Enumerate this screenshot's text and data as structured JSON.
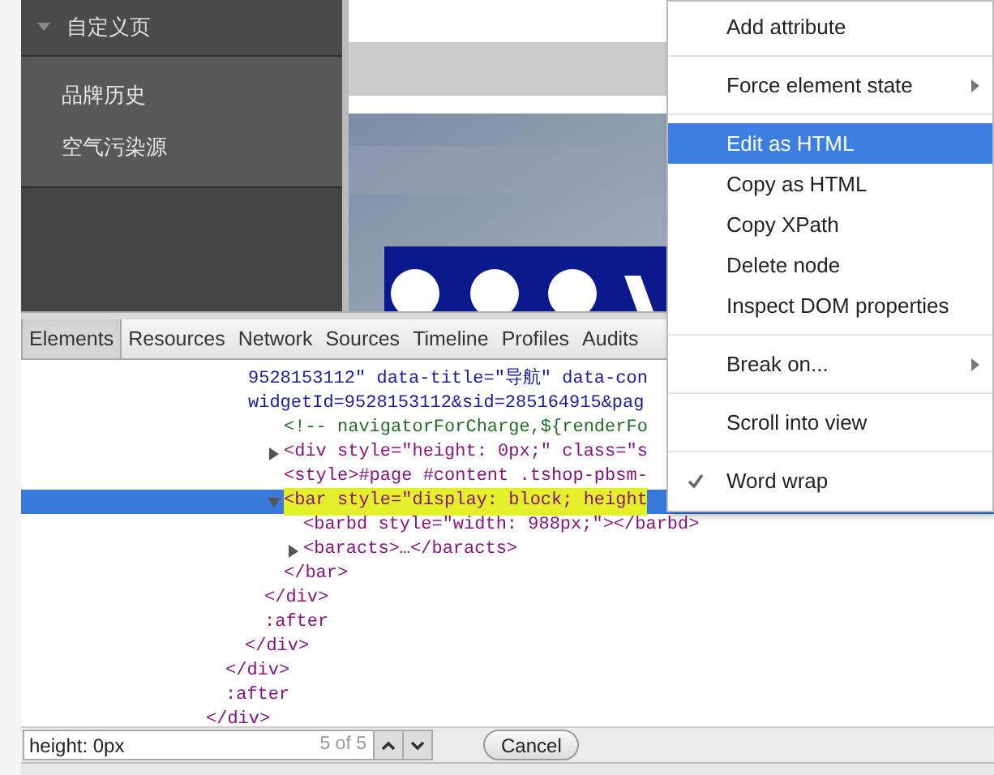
{
  "sidebar": {
    "header": {
      "label": "自定义页",
      "expanded": true
    },
    "items": [
      {
        "label": "品牌历史"
      },
      {
        "label": "空气污染源"
      }
    ]
  },
  "devtools": {
    "tabs": [
      {
        "label": "Elements",
        "selected": true
      },
      {
        "label": "Resources",
        "selected": false
      },
      {
        "label": "Network",
        "selected": false
      },
      {
        "label": "Sources",
        "selected": false
      },
      {
        "label": "Timeline",
        "selected": false
      },
      {
        "label": "Profiles",
        "selected": false
      },
      {
        "label": "Audits",
        "selected": false
      }
    ],
    "dom_tree": [
      {
        "children": [
          {
            "children": [
              {
                "children": [
                  {
                    "lines": [
                      "9528153112\" data-title=\"导航\" data-con",
                      "widgetId=9528153112&sid=285164915&pag"
                    ],
                    "children": [
                      {
                        "text": "<!-- navigatorForCharge,${renderFo",
                        "kind": "comment"
                      },
                      {
                        "text": "<div style=\"height: 0px;\" class=\"s",
                        "kind": "tag",
                        "expanded": false
                      },
                      {
                        "text": "<style>#page #content .tshop-pbsm-",
                        "kind": "tag"
                      },
                      {
                        "text": "<bar style=\"display: block; height",
                        "kind": "tag",
                        "expanded": true,
                        "selected": true,
                        "search_match": true,
                        "children": [
                          {
                            "text": "<barbd style=\"width: 988px;\"></barbd>",
                            "kind": "tag"
                          },
                          {
                            "text": "<baracts>…</baracts>",
                            "kind": "tag",
                            "expanded": false
                          }
                        ],
                        "close": "</bar>"
                      }
                    ],
                    "close": "</div>"
                  },
                  {
                    "text": ":after",
                    "kind": "pseudo"
                  }
                ],
                "close": "</div>"
              }
            ],
            "close": "</div>"
          },
          {
            "text": ":after",
            "kind": "pseudo"
          }
        ],
        "close": "</div>"
      }
    ],
    "search": {
      "value": "height: 0px",
      "count": "5 of 5",
      "cancel": "Cancel"
    }
  },
  "context_menu": [
    {
      "kind": "item",
      "label": "Add attribute",
      "selected": false
    },
    {
      "kind": "separator"
    },
    {
      "kind": "item",
      "label": "Force element state",
      "submenu": true,
      "selected": false
    },
    {
      "kind": "separator"
    },
    {
      "kind": "item",
      "label": "Edit as HTML",
      "selected": true
    },
    {
      "kind": "item",
      "label": "Copy as HTML",
      "selected": false
    },
    {
      "kind": "item",
      "label": "Copy XPath",
      "selected": false
    },
    {
      "kind": "item",
      "label": "Delete node",
      "selected": false
    },
    {
      "kind": "item",
      "label": "Inspect DOM properties",
      "selected": false
    },
    {
      "kind": "separator"
    },
    {
      "kind": "item",
      "label": "Break on...",
      "submenu": true,
      "selected": false
    },
    {
      "kind": "separator"
    },
    {
      "kind": "item",
      "label": "Scroll into view",
      "selected": false
    },
    {
      "kind": "separator"
    },
    {
      "kind": "item",
      "label": "Word wrap",
      "checked": true,
      "selected": false
    }
  ]
}
